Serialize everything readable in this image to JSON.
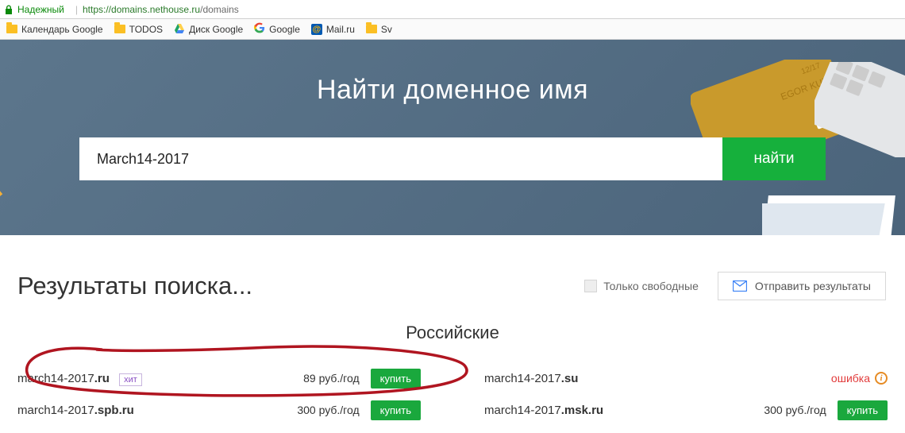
{
  "browser": {
    "trusted_label": "Надежный",
    "url_scheme": "https://",
    "url_host": "domains.nethouse.ru",
    "url_path": "/domains",
    "bookmarks": [
      {
        "icon": "folder",
        "label": "Календарь Google"
      },
      {
        "icon": "folder",
        "label": "TODOS"
      },
      {
        "icon": "gdrive",
        "label": "Диск Google"
      },
      {
        "icon": "g",
        "label": "Google"
      },
      {
        "icon": "mailru",
        "label": "Mail.ru"
      },
      {
        "icon": "folder",
        "label": "Sv"
      }
    ]
  },
  "hero": {
    "title": "Найти доменное имя",
    "search_value": "March14-2017",
    "search_btn": "найти"
  },
  "results": {
    "heading": "Результаты поиска...",
    "only_free_label": "Только свободные",
    "send_label": "Отправить результаты",
    "category": "Российские",
    "left": [
      {
        "base": "march14-2017",
        "tld": ".ru",
        "hit": "хит",
        "price": "89 руб./год",
        "action": "buy",
        "buy_label": "купить"
      },
      {
        "base": "march14-2017",
        "tld": ".spb.ru",
        "hit": "",
        "price": "300 руб./год",
        "action": "buy",
        "buy_label": "купить"
      }
    ],
    "right": [
      {
        "base": "march14-2017",
        "tld": ".su",
        "hit": "",
        "price": "",
        "action": "error",
        "err_label": "ошибка"
      },
      {
        "base": "march14-2017",
        "tld": ".msk.ru",
        "hit": "",
        "price": "300 руб./год",
        "action": "buy",
        "buy_label": "купить"
      }
    ]
  }
}
